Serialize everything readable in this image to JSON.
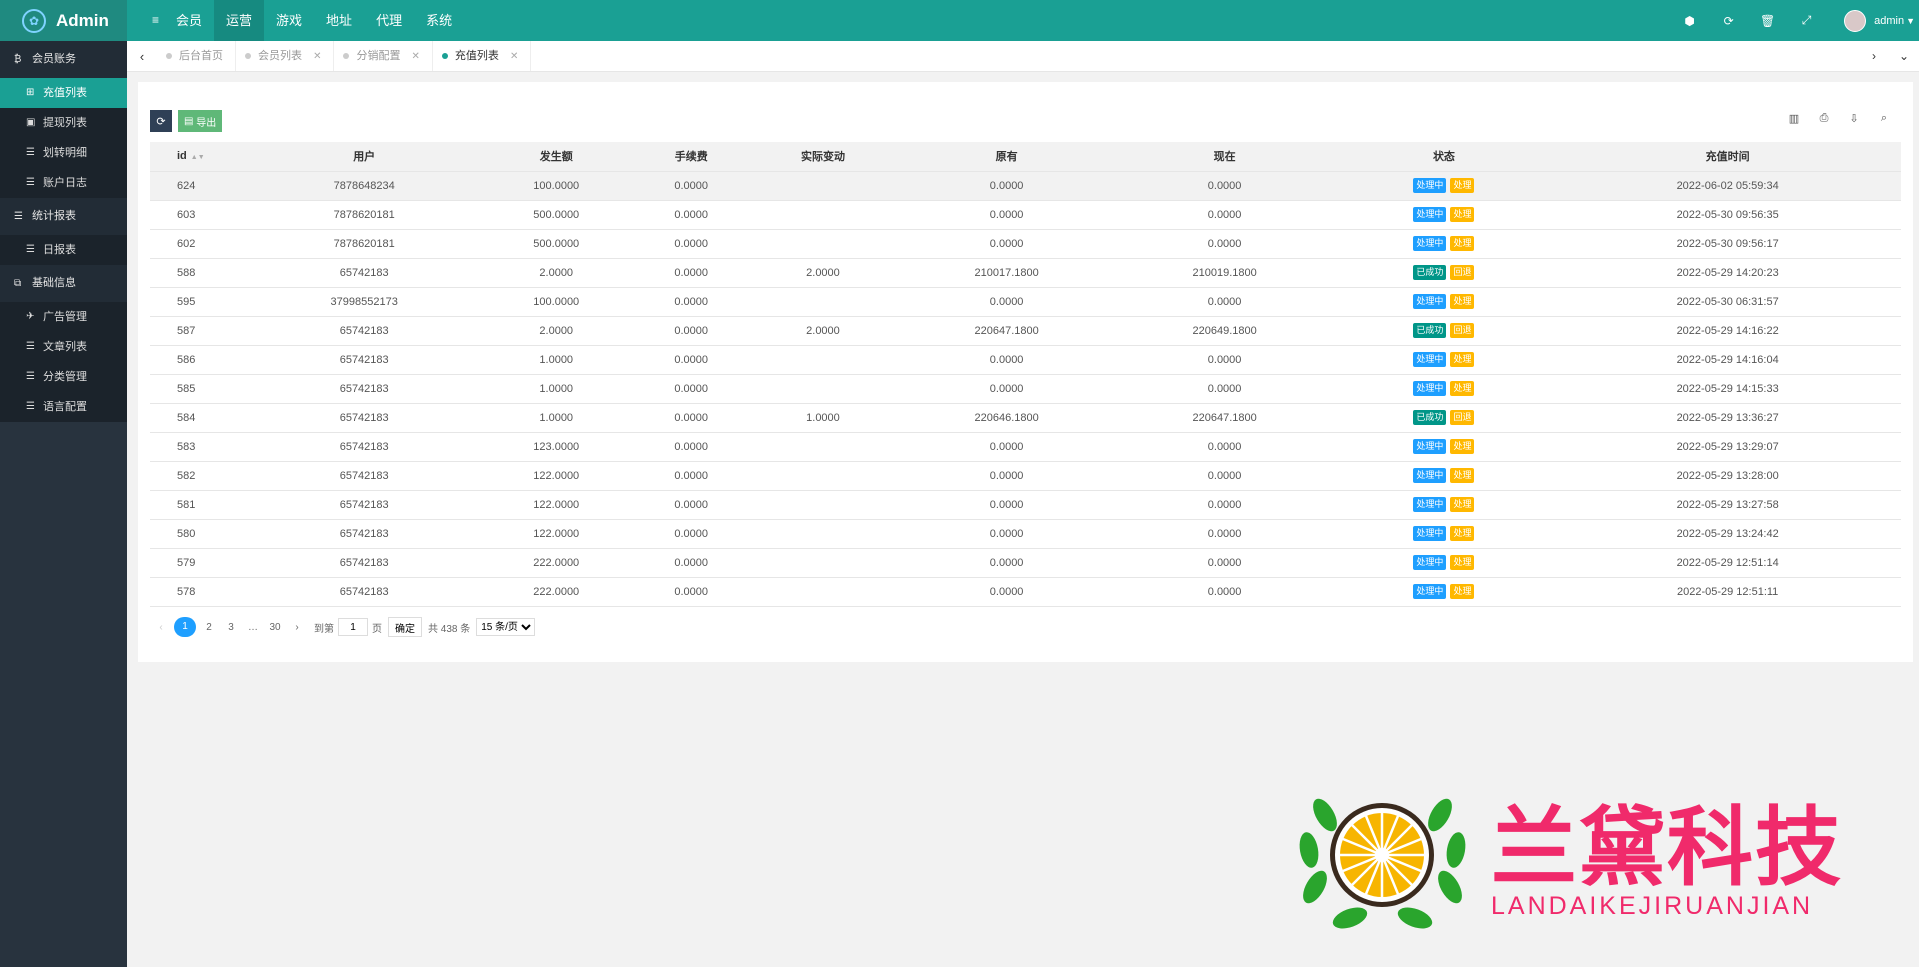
{
  "app": {
    "logo_text": "Admin",
    "logo_icon": "gear-flower-icon"
  },
  "topnav": {
    "menu_icon": "≡",
    "items": [
      {
        "label": "会员",
        "active": false
      },
      {
        "label": "运营",
        "active": true
      },
      {
        "label": "游戏",
        "active": false
      },
      {
        "label": "地址",
        "active": false
      },
      {
        "label": "代理",
        "active": false
      },
      {
        "label": "系统",
        "active": false
      }
    ]
  },
  "topright": {
    "icons": [
      "clear-cache-icon",
      "refresh-icon",
      "trash-icon",
      "fullscreen-icon"
    ],
    "username": "admin"
  },
  "sidebar": {
    "groups": [
      {
        "label": "会员账务",
        "items": [
          {
            "label": "充值列表",
            "active": true
          },
          {
            "label": "提现列表",
            "active": false
          },
          {
            "label": "划转明细",
            "active": false
          },
          {
            "label": "账户日志",
            "active": false
          }
        ]
      },
      {
        "label": "统计报表",
        "items": [
          {
            "label": "日报表",
            "active": false
          }
        ]
      },
      {
        "label": "基础信息",
        "items": [
          {
            "label": "广告管理",
            "active": false
          },
          {
            "label": "文章列表",
            "active": false
          },
          {
            "label": "分类管理",
            "active": false
          },
          {
            "label": "语言配置",
            "active": false
          }
        ]
      }
    ]
  },
  "tabs": [
    {
      "label": "后台首页",
      "closable": false,
      "active": false
    },
    {
      "label": "会员列表",
      "closable": true,
      "active": false
    },
    {
      "label": "分销配置",
      "closable": true,
      "active": false
    },
    {
      "label": "充值列表",
      "closable": true,
      "active": true
    }
  ],
  "toolbar": {
    "export_label": "导出"
  },
  "table": {
    "headers": [
      "id",
      "用户",
      "发生额",
      "手续费",
      "实际变动",
      "原有",
      "现在",
      "状态",
      "充值时间"
    ],
    "rows": [
      {
        "id": "624",
        "user": "7878648234",
        "amount": "100.0000",
        "fee": "0.0000",
        "actual": "",
        "before": "0.0000",
        "after": "0.0000",
        "status": "处理中",
        "action": "处理",
        "status_color": "blue",
        "time": "2022-06-02 05:59:34"
      },
      {
        "id": "603",
        "user": "7878620181",
        "amount": "500.0000",
        "fee": "0.0000",
        "actual": "",
        "before": "0.0000",
        "after": "0.0000",
        "status": "处理中",
        "action": "处理",
        "status_color": "blue",
        "time": "2022-05-30 09:56:35"
      },
      {
        "id": "602",
        "user": "7878620181",
        "amount": "500.0000",
        "fee": "0.0000",
        "actual": "",
        "before": "0.0000",
        "after": "0.0000",
        "status": "处理中",
        "action": "处理",
        "status_color": "blue",
        "time": "2022-05-30 09:56:17"
      },
      {
        "id": "588",
        "user": "65742183",
        "amount": "2.0000",
        "fee": "0.0000",
        "actual": "2.0000",
        "before": "210017.1800",
        "after": "210019.1800",
        "status": "已成功",
        "action": "回退",
        "status_color": "green",
        "time": "2022-05-29 14:20:23"
      },
      {
        "id": "595",
        "user": "37998552173",
        "amount": "100.0000",
        "fee": "0.0000",
        "actual": "",
        "before": "0.0000",
        "after": "0.0000",
        "status": "处理中",
        "action": "处理",
        "status_color": "blue",
        "time": "2022-05-30 06:31:57"
      },
      {
        "id": "587",
        "user": "65742183",
        "amount": "2.0000",
        "fee": "0.0000",
        "actual": "2.0000",
        "before": "220647.1800",
        "after": "220649.1800",
        "status": "已成功",
        "action": "回退",
        "status_color": "green",
        "time": "2022-05-29 14:16:22"
      },
      {
        "id": "586",
        "user": "65742183",
        "amount": "1.0000",
        "fee": "0.0000",
        "actual": "",
        "before": "0.0000",
        "after": "0.0000",
        "status": "处理中",
        "action": "处理",
        "status_color": "blue",
        "time": "2022-05-29 14:16:04"
      },
      {
        "id": "585",
        "user": "65742183",
        "amount": "1.0000",
        "fee": "0.0000",
        "actual": "",
        "before": "0.0000",
        "after": "0.0000",
        "status": "处理中",
        "action": "处理",
        "status_color": "blue",
        "time": "2022-05-29 14:15:33"
      },
      {
        "id": "584",
        "user": "65742183",
        "amount": "1.0000",
        "fee": "0.0000",
        "actual": "1.0000",
        "before": "220646.1800",
        "after": "220647.1800",
        "status": "已成功",
        "action": "回退",
        "status_color": "green",
        "time": "2022-05-29 13:36:27"
      },
      {
        "id": "583",
        "user": "65742183",
        "amount": "123.0000",
        "fee": "0.0000",
        "actual": "",
        "before": "0.0000",
        "after": "0.0000",
        "status": "处理中",
        "action": "处理",
        "status_color": "blue",
        "time": "2022-05-29 13:29:07"
      },
      {
        "id": "582",
        "user": "65742183",
        "amount": "122.0000",
        "fee": "0.0000",
        "actual": "",
        "before": "0.0000",
        "after": "0.0000",
        "status": "处理中",
        "action": "处理",
        "status_color": "blue",
        "time": "2022-05-29 13:28:00"
      },
      {
        "id": "581",
        "user": "65742183",
        "amount": "122.0000",
        "fee": "0.0000",
        "actual": "",
        "before": "0.0000",
        "after": "0.0000",
        "status": "处理中",
        "action": "处理",
        "status_color": "blue",
        "time": "2022-05-29 13:27:58"
      },
      {
        "id": "580",
        "user": "65742183",
        "amount": "122.0000",
        "fee": "0.0000",
        "actual": "",
        "before": "0.0000",
        "after": "0.0000",
        "status": "处理中",
        "action": "处理",
        "status_color": "blue",
        "time": "2022-05-29 13:24:42"
      },
      {
        "id": "579",
        "user": "65742183",
        "amount": "222.0000",
        "fee": "0.0000",
        "actual": "",
        "before": "0.0000",
        "after": "0.0000",
        "status": "处理中",
        "action": "处理",
        "status_color": "blue",
        "time": "2022-05-29 12:51:14"
      },
      {
        "id": "578",
        "user": "65742183",
        "amount": "222.0000",
        "fee": "0.0000",
        "actual": "",
        "before": "0.0000",
        "after": "0.0000",
        "status": "处理中",
        "action": "处理",
        "status_color": "blue",
        "time": "2022-05-29 12:51:11"
      }
    ]
  },
  "pager": {
    "pages": [
      "1",
      "2",
      "3"
    ],
    "ellipsis": "…",
    "last": "30",
    "current": "1",
    "goto_label": "到第",
    "goto_value": "1",
    "page_unit": "页",
    "confirm_label": "确定",
    "total_label": "共 438 条",
    "size_option": "15 条/页"
  },
  "watermark": {
    "title": "兰黛科技",
    "subtitle": "LANDAIKEJIRUANJIAN"
  },
  "colors": {
    "primary": "#1aa094",
    "sidebar": "#28333e",
    "badge_blue": "#1e9fff",
    "badge_orange": "#ffb800",
    "badge_green": "#009688",
    "watermark": "#f02a6b"
  }
}
